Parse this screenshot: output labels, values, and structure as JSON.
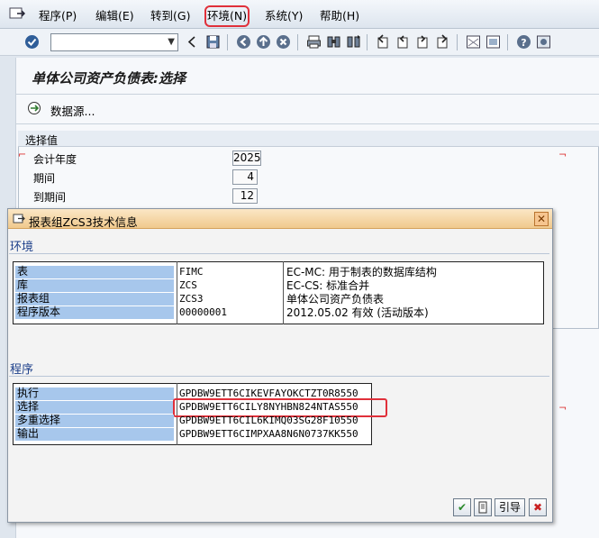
{
  "menu": {
    "items": [
      {
        "label": "程序(P)"
      },
      {
        "label": "编辑(E)"
      },
      {
        "label": "转到(G)"
      },
      {
        "label": "环境(N)"
      },
      {
        "label": "系统(Y)"
      },
      {
        "label": "帮助(H)"
      }
    ]
  },
  "toolbar": {
    "command_field_value": "",
    "icons": [
      "enter-icon",
      "back-icon",
      "save-icon",
      "back-arrow-icon",
      "exit-icon",
      "cancel-icon",
      "print-icon",
      "find-icon",
      "find-next-icon",
      "first-page-icon",
      "previous-page-icon",
      "next-page-icon",
      "last-page-icon",
      "new-session-icon",
      "shortcut-icon",
      "help-icon",
      "customize-icon"
    ]
  },
  "main": {
    "title": "单体公司资产负债表:选择",
    "datasource_label": "数据源...",
    "selection": {
      "group_label": "选择值",
      "fields": [
        {
          "label": "会计年度",
          "value": "2025"
        },
        {
          "label": "期间",
          "value": "4"
        },
        {
          "label": "到期间",
          "value": "12"
        }
      ]
    }
  },
  "dialog": {
    "title": "报表组ZCS3技术信息",
    "environment": {
      "title": "环境",
      "rows": [
        {
          "label": "表",
          "value": "FIMC",
          "desc": "EC-MC: 用于制表的数据库结构"
        },
        {
          "label": "库",
          "value": "ZCS",
          "desc": "EC-CS: 标准合并"
        },
        {
          "label": "报表组",
          "value": "ZCS3",
          "desc": "单体公司资产负债表"
        },
        {
          "label": "程序版本",
          "value": "00000001",
          "desc": "2012.05.02 有效 (活动版本)"
        }
      ]
    },
    "program": {
      "title": "程序",
      "rows": [
        {
          "label": "执行",
          "value": "GPDBW9ETT6CIKEVFAYOKCTZT0R8550"
        },
        {
          "label": "选择",
          "value": "GPDBW9ETT6CILY8NYHBN824NTAS550"
        },
        {
          "label": "多重选择",
          "value": "GPDBW9ETT6CIL6KIMQ03SG28F10550"
        },
        {
          "label": "输出",
          "value": "GPDBW9ETT6CIMPXAA8N6N0737KK550"
        }
      ]
    },
    "buttons": {
      "ok": "✔",
      "print": "print-icon",
      "where_used": "引导",
      "cancel": "✖"
    }
  },
  "colors": {
    "highlight": "#e0303a",
    "label_cell": "#a7c7ec",
    "dialog_header": "#f0c98d"
  }
}
